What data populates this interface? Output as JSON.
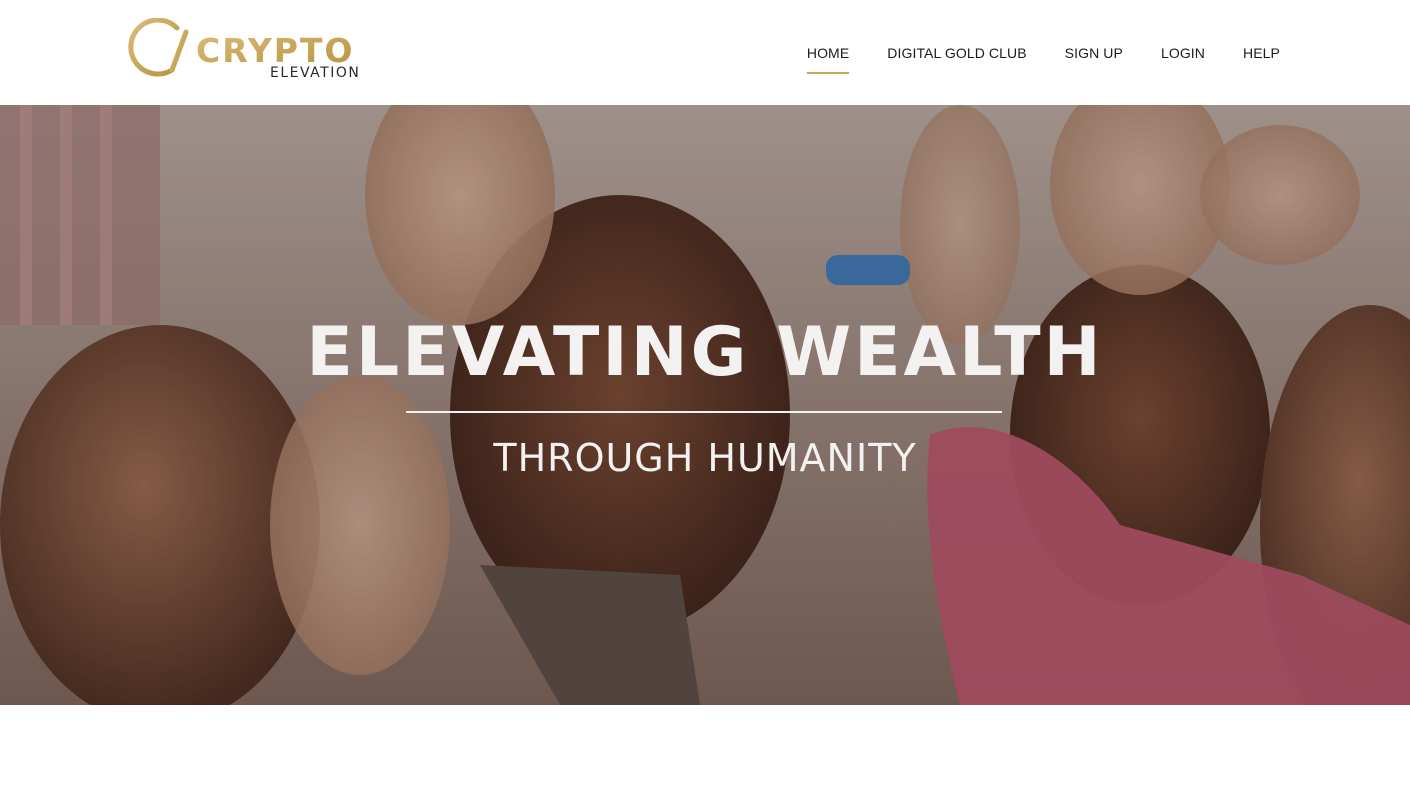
{
  "brand": {
    "logo_word": "CRYPTO",
    "logo_subword": "ELEVATION",
    "logo_color": "#c9a65a",
    "logo_subword_color": "#2a2a2a"
  },
  "nav": {
    "items": [
      {
        "label": "HOME",
        "active": true
      },
      {
        "label": "DIGITAL GOLD CLUB",
        "active": false
      },
      {
        "label": "SIGN UP",
        "active": false
      },
      {
        "label": "LOGIN",
        "active": false
      },
      {
        "label": "HELP",
        "active": false
      }
    ],
    "active_underline_color": "#c9a65a"
  },
  "hero": {
    "title": "ELEVATING WEALTH",
    "subtitle": "THROUGH HUMANITY",
    "text_color": "#f4f1f1"
  }
}
